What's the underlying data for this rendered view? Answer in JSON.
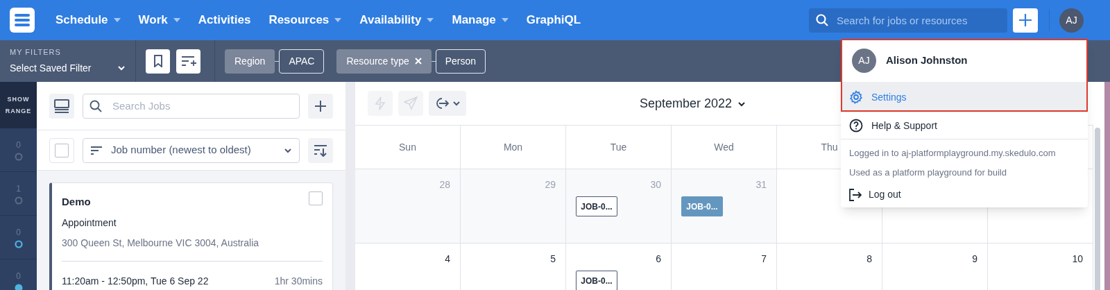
{
  "nav": {
    "items": [
      {
        "label": "Schedule",
        "has_menu": true
      },
      {
        "label": "Work",
        "has_menu": true
      },
      {
        "label": "Activities",
        "has_menu": false
      },
      {
        "label": "Resources",
        "has_menu": true
      },
      {
        "label": "Availability",
        "has_menu": true
      },
      {
        "label": "Manage",
        "has_menu": true
      },
      {
        "label": "GraphiQL",
        "has_menu": false
      }
    ],
    "search_placeholder": "Search for jobs or resources",
    "avatar": "AJ"
  },
  "filters": {
    "label": "MY FILTERS",
    "saved_filter": "Select Saved Filter",
    "chips": [
      {
        "name": "Region",
        "value": "APAC",
        "removable": false
      },
      {
        "name": "Resource type",
        "value": "Person",
        "removable": true
      }
    ]
  },
  "range": {
    "label": "SHOW RANGE",
    "rows": [
      {
        "count": "0",
        "kind": "empty"
      },
      {
        "count": "1",
        "kind": "empty"
      },
      {
        "count": "0",
        "kind": "ring"
      },
      {
        "count": "0",
        "kind": "dot"
      }
    ]
  },
  "jobs": {
    "search_placeholder": "Search Jobs",
    "select_all": false,
    "sort": "Job number (newest to oldest)",
    "cards": [
      {
        "title": "Demo",
        "type": "Appointment",
        "address": "300 Queen St, Melbourne VIC 3004, Australia",
        "time": "11:20am - 12:50pm, Tue 6 Sep 22",
        "duration": "1hr 30mins",
        "checked": false
      }
    ]
  },
  "calendar": {
    "toolbar": [
      {
        "disabled": true
      },
      {
        "disabled": true
      },
      {
        "disabled": false
      }
    ],
    "title": "September 2022",
    "weekdays": [
      "Sun",
      "Mon",
      "Tue",
      "Wed",
      "Thu"
    ],
    "weeks": [
      [
        {
          "day": "28",
          "other_month": true
        },
        {
          "day": "29",
          "other_month": true
        },
        {
          "day": "30",
          "other_month": true,
          "jobs": [
            {
              "label": "JOB-0...",
              "kind": "outline"
            }
          ]
        },
        {
          "day": "31",
          "other_month": true,
          "jobs": [
            {
              "label": "JOB-0...",
              "kind": "filled"
            }
          ]
        }
      ],
      [
        {
          "day": "4",
          "other_month": false
        },
        {
          "day": "5",
          "other_month": false
        },
        {
          "day": "6",
          "other_month": false,
          "jobs": [
            {
              "label": "JOB-0...",
              "kind": "outline"
            }
          ]
        },
        {
          "day": "7",
          "other_month": false
        },
        {
          "day": "8",
          "other_month": false
        },
        {
          "day": "9",
          "other_month": false
        },
        {
          "day": "10",
          "other_month": false
        }
      ]
    ]
  },
  "user_menu": {
    "initials": "AJ",
    "name": "Alison Johnston",
    "items": [
      {
        "label": "Settings",
        "selected": true
      },
      {
        "label": "Help & Support",
        "selected": false
      }
    ],
    "info": [
      "Logged in to aj-platformplayground.my.skedulo.com",
      "Used as a platform playground for build"
    ],
    "logout": "Log out"
  }
}
